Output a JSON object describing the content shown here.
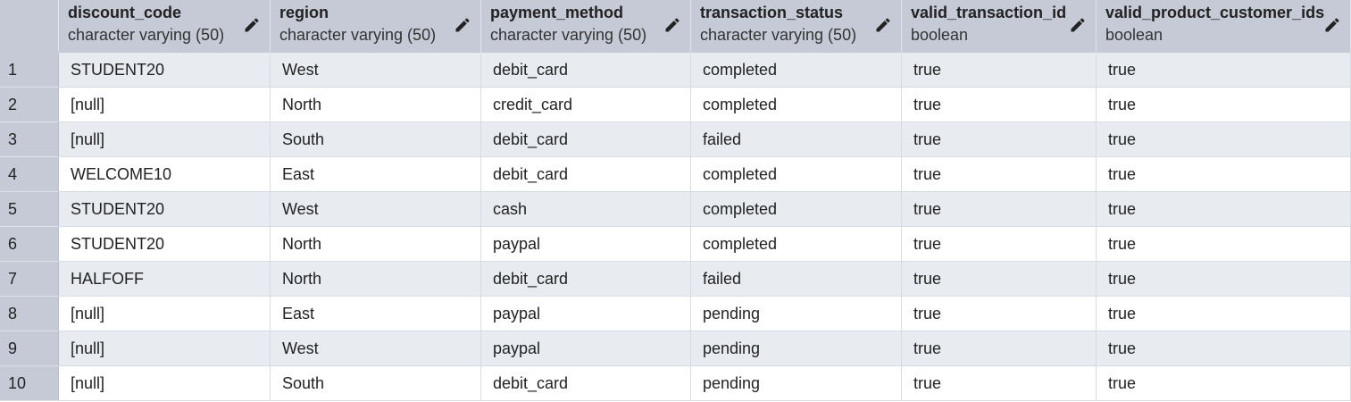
{
  "columns": [
    {
      "name": "discount_code",
      "type": "character varying (50)"
    },
    {
      "name": "region",
      "type": "character varying (50)"
    },
    {
      "name": "payment_method",
      "type": "character varying (50)"
    },
    {
      "name": "transaction_status",
      "type": "character varying (50)"
    },
    {
      "name": "valid_transaction_id",
      "type": "boolean"
    },
    {
      "name": "valid_product_customer_ids",
      "type": "boolean"
    }
  ],
  "rows": [
    {
      "num": "1",
      "cells": [
        "STUDENT20",
        "West",
        "debit_card",
        "completed",
        "true",
        "true"
      ]
    },
    {
      "num": "2",
      "cells": [
        "[null]",
        "North",
        "credit_card",
        "completed",
        "true",
        "true"
      ]
    },
    {
      "num": "3",
      "cells": [
        "[null]",
        "South",
        "debit_card",
        "failed",
        "true",
        "true"
      ]
    },
    {
      "num": "4",
      "cells": [
        "WELCOME10",
        "East",
        "debit_card",
        "completed",
        "true",
        "true"
      ]
    },
    {
      "num": "5",
      "cells": [
        "STUDENT20",
        "West",
        "cash",
        "completed",
        "true",
        "true"
      ]
    },
    {
      "num": "6",
      "cells": [
        "STUDENT20",
        "North",
        "paypal",
        "completed",
        "true",
        "true"
      ]
    },
    {
      "num": "7",
      "cells": [
        "HALFOFF",
        "North",
        "debit_card",
        "failed",
        "true",
        "true"
      ]
    },
    {
      "num": "8",
      "cells": [
        "[null]",
        "East",
        "paypal",
        "pending",
        "true",
        "true"
      ]
    },
    {
      "num": "9",
      "cells": [
        "[null]",
        "West",
        "paypal",
        "pending",
        "true",
        "true"
      ]
    },
    {
      "num": "10",
      "cells": [
        "[null]",
        "South",
        "debit_card",
        "pending",
        "true",
        "true"
      ]
    }
  ],
  "icons": {
    "edit": "pencil-icon"
  },
  "colors": {
    "header_bg": "#c5cad6",
    "row_alt_bg": "#e8ebf0",
    "row_bg": "#ffffff"
  }
}
